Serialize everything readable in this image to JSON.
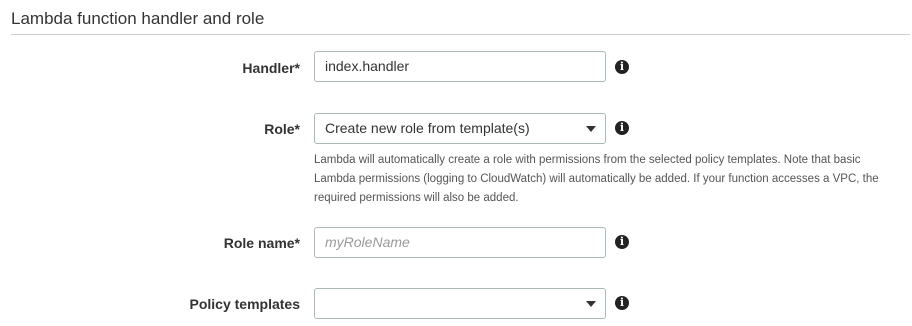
{
  "section": {
    "title": "Lambda function handler and role"
  },
  "handler": {
    "label": "Handler*",
    "value": "index.handler",
    "info_icon": "info-circle-icon"
  },
  "role": {
    "label": "Role*",
    "selected": "Create new role from template(s)",
    "help": "Lambda will automatically create a role with permissions from the selected policy templates. Note that basic Lambda permissions (logging to CloudWatch) will automatically be added. If your function accesses a VPC, the required permissions will also be added.",
    "info_icon": "info-circle-icon"
  },
  "role_name": {
    "label": "Role name*",
    "value": "",
    "placeholder": "myRoleName",
    "info_icon": "info-circle-icon"
  },
  "policy_templates": {
    "label": "Policy templates",
    "selected": "",
    "info_icon": "info-circle-icon"
  }
}
